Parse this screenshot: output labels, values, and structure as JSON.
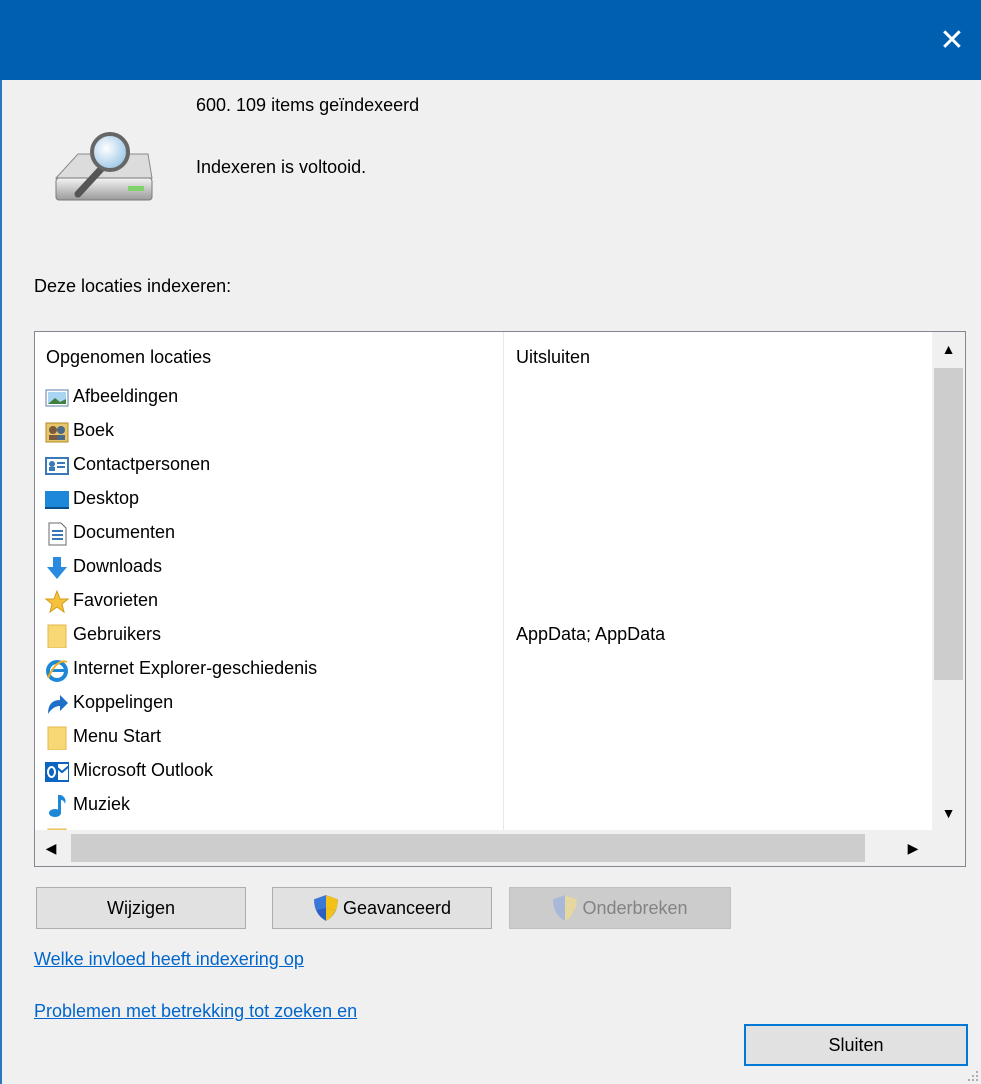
{
  "window": {
    "close_glyph": "✕"
  },
  "status": {
    "item_count": "600. 109 items geïndexeerd",
    "state": "Indexeren is voltooid."
  },
  "locations_label": "Deze locaties indexeren:",
  "table": {
    "headers": {
      "included": "Opgenomen locaties",
      "exclude": "Uitsluiten"
    },
    "rows": [
      {
        "icon": "pictures-icon",
        "label": "Afbeeldingen",
        "exclude": ""
      },
      {
        "icon": "book-icon",
        "label": "Boek",
        "exclude": ""
      },
      {
        "icon": "contacts-icon",
        "label": "Contactpersonen",
        "exclude": ""
      },
      {
        "icon": "desktop-icon",
        "label": "Desktop",
        "exclude": ""
      },
      {
        "icon": "documents-icon",
        "label": "Documenten",
        "exclude": ""
      },
      {
        "icon": "downloads-icon",
        "label": "Downloads",
        "exclude": ""
      },
      {
        "icon": "favorites-icon",
        "label": "Favorieten",
        "exclude": ""
      },
      {
        "icon": "folder-icon",
        "label": "Gebruikers",
        "exclude": "AppData; AppData"
      },
      {
        "icon": "internet-explorer-icon",
        "label": "Internet Explorer-geschiedenis",
        "exclude": ""
      },
      {
        "icon": "links-icon",
        "label": "Koppelingen",
        "exclude": ""
      },
      {
        "icon": "folder-icon",
        "label": "Menu Start",
        "exclude": ""
      },
      {
        "icon": "outlook-icon",
        "label": "Microsoft Outlook",
        "exclude": ""
      },
      {
        "icon": "music-icon",
        "label": "Muziek",
        "exclude": ""
      }
    ]
  },
  "buttons": {
    "modify": "Wijzigen",
    "advanced": "Geavanceerd",
    "pause": "Onderbreken",
    "close": "Sluiten"
  },
  "links": {
    "impact": "Welke invloed heeft indexering op",
    "troubleshoot": "Problemen met betrekking tot zoeken en"
  },
  "colors": {
    "titlebar": "#005fb0",
    "link": "#0066cc",
    "accent_border": "#0078d7"
  }
}
